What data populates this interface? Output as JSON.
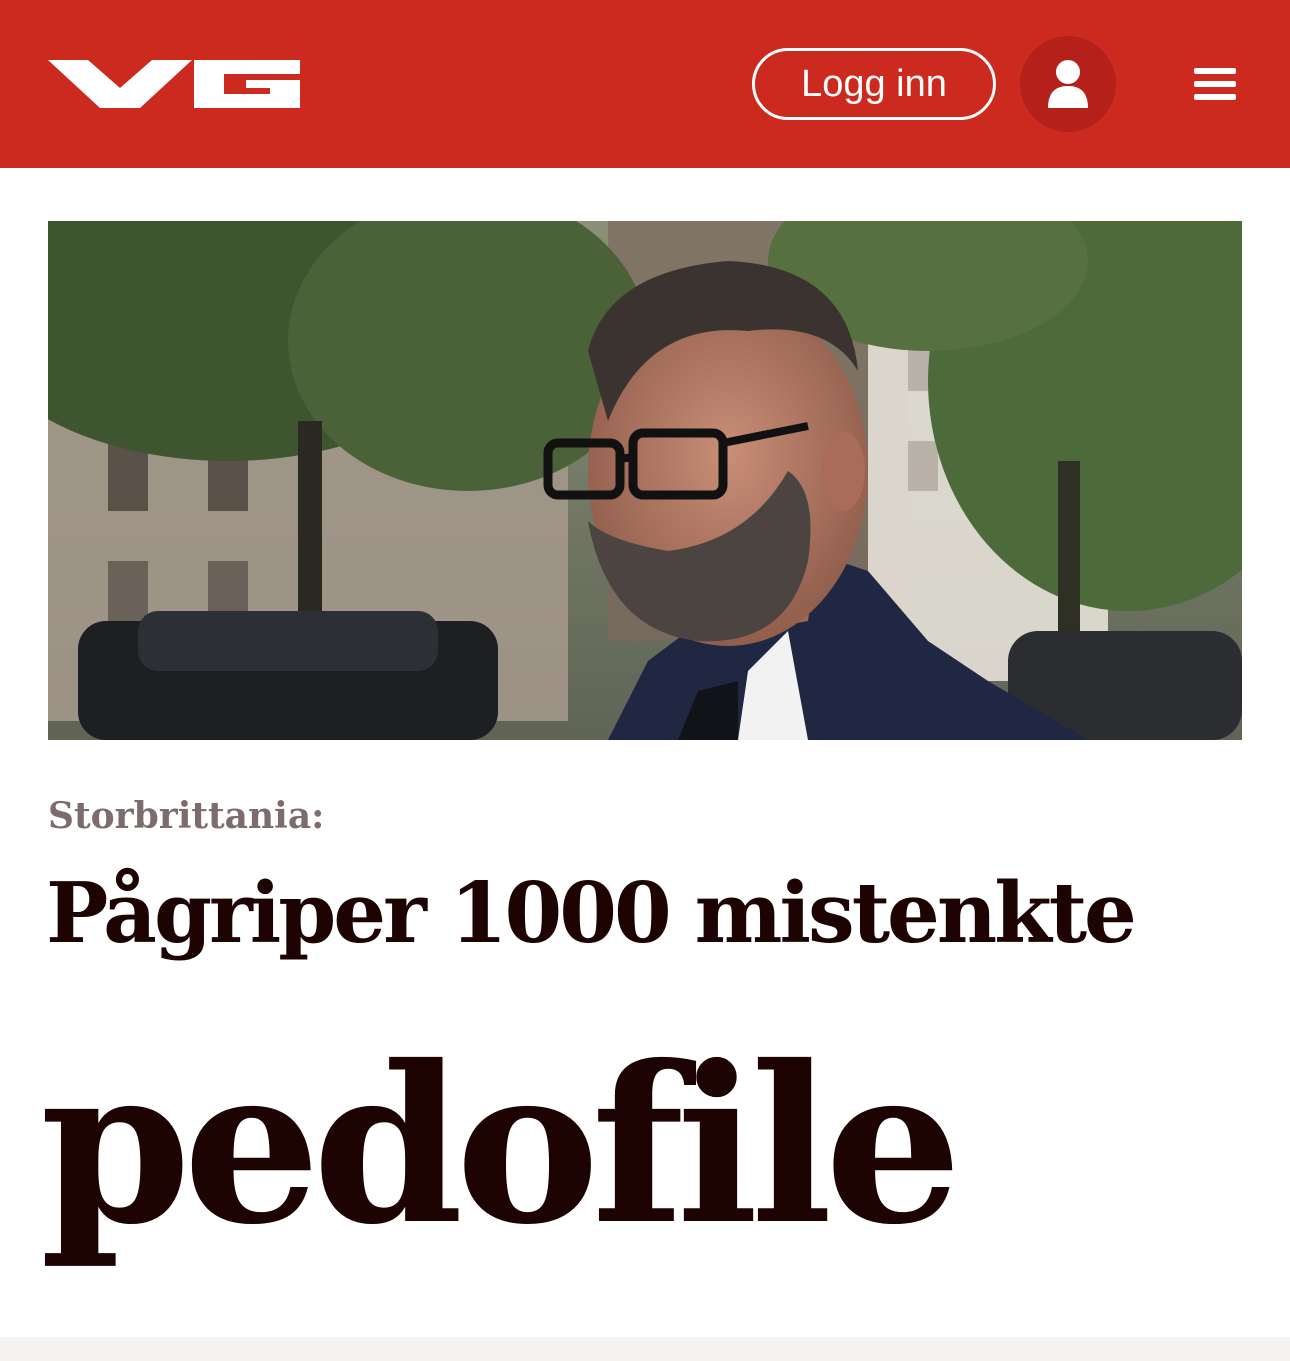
{
  "header": {
    "logo_text": "VG",
    "login_label": "Logg inn",
    "user_icon": "user-icon",
    "menu_icon": "hamburger-menu-icon",
    "brand_color": "#cc2a1e"
  },
  "article": {
    "kicker": "Storbrittania:",
    "headline_line1": "Pågriper 1000 mistenkte",
    "headline_line2": "pedofile",
    "text_color": "#1e0303",
    "kicker_color": "#7d6c6c"
  }
}
